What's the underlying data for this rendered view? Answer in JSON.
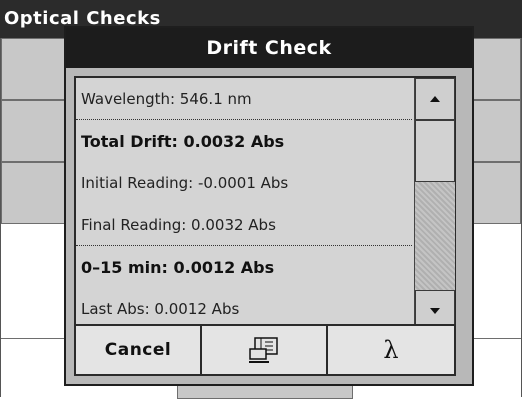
{
  "background_window": {
    "title": "Optical Checks"
  },
  "dialog": {
    "title": "Drift Check",
    "rows": [
      {
        "text": "Wavelength: 546.1 nm"
      },
      {
        "text": "Total Drift:  0.0032 Abs"
      },
      {
        "text": "Initial Reading: -0.0001 Abs"
      },
      {
        "text": "Final Reading:  0.0032 Abs"
      },
      {
        "text": "0–15 min:  0.0012 Abs"
      },
      {
        "text": "Last Abs:  0.0012 Abs"
      }
    ],
    "buttons": {
      "cancel": "Cancel",
      "print_icon": "printer-computer-icon",
      "lambda": "λ"
    },
    "icons": {
      "scroll_up": "arrow-up-icon",
      "scroll_down": "arrow-down-icon"
    }
  }
}
